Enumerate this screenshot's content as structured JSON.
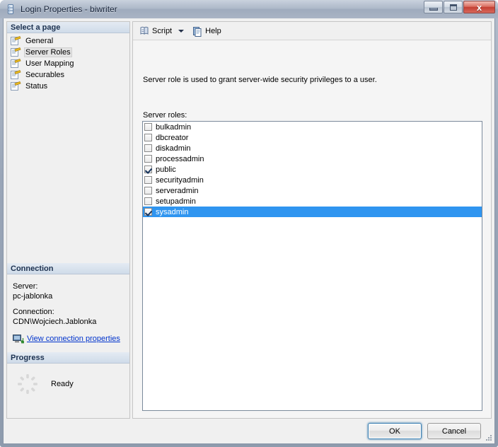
{
  "window": {
    "title": "Login Properties - biwriter",
    "icon": "server-login-icon",
    "minimize_label": "",
    "maximize_label": "",
    "close_label": "x"
  },
  "sidebar": {
    "select_page_header": "Select a page",
    "items": [
      {
        "label": "General",
        "icon": "page-icon",
        "selected": false
      },
      {
        "label": "Server Roles",
        "icon": "page-icon",
        "selected": true
      },
      {
        "label": "User Mapping",
        "icon": "page-icon",
        "selected": false
      },
      {
        "label": "Securables",
        "icon": "page-icon",
        "selected": false
      },
      {
        "label": "Status",
        "icon": "page-icon",
        "selected": false
      }
    ],
    "connection": {
      "header": "Connection",
      "server_label": "Server:",
      "server_value": "pc-jablonka",
      "connection_label": "Connection:",
      "connection_value": "CDN\\Wojciech.Jablonka",
      "link_text": "View connection properties",
      "link_icon": "connection-properties-icon"
    },
    "progress": {
      "header": "Progress",
      "status": "Ready",
      "icon": "spinner-icon"
    }
  },
  "toolbar": {
    "script_label": "Script",
    "script_icon": "script-scroll-icon",
    "dropdown_icon": "chevron-down-icon",
    "help_label": "Help",
    "help_icon": "help-page-icon"
  },
  "main": {
    "description": "Server role is used to grant server-wide security privileges to a user.",
    "roles_label": "Server roles:",
    "roles": [
      {
        "name": "bulkadmin",
        "checked": false,
        "selected": false
      },
      {
        "name": "dbcreator",
        "checked": false,
        "selected": false
      },
      {
        "name": "diskadmin",
        "checked": false,
        "selected": false
      },
      {
        "name": "processadmin",
        "checked": false,
        "selected": false
      },
      {
        "name": "public",
        "checked": true,
        "selected": false
      },
      {
        "name": "securityadmin",
        "checked": false,
        "selected": false
      },
      {
        "name": "serveradmin",
        "checked": false,
        "selected": false
      },
      {
        "name": "setupadmin",
        "checked": false,
        "selected": false
      },
      {
        "name": "sysadmin",
        "checked": true,
        "selected": true
      }
    ]
  },
  "footer": {
    "ok_label": "OK",
    "cancel_label": "Cancel"
  },
  "colors": {
    "selection_blue": "#2f95f0",
    "link_blue": "#0033cc",
    "close_red": "#c43f33",
    "header_text": "#1c3150"
  }
}
